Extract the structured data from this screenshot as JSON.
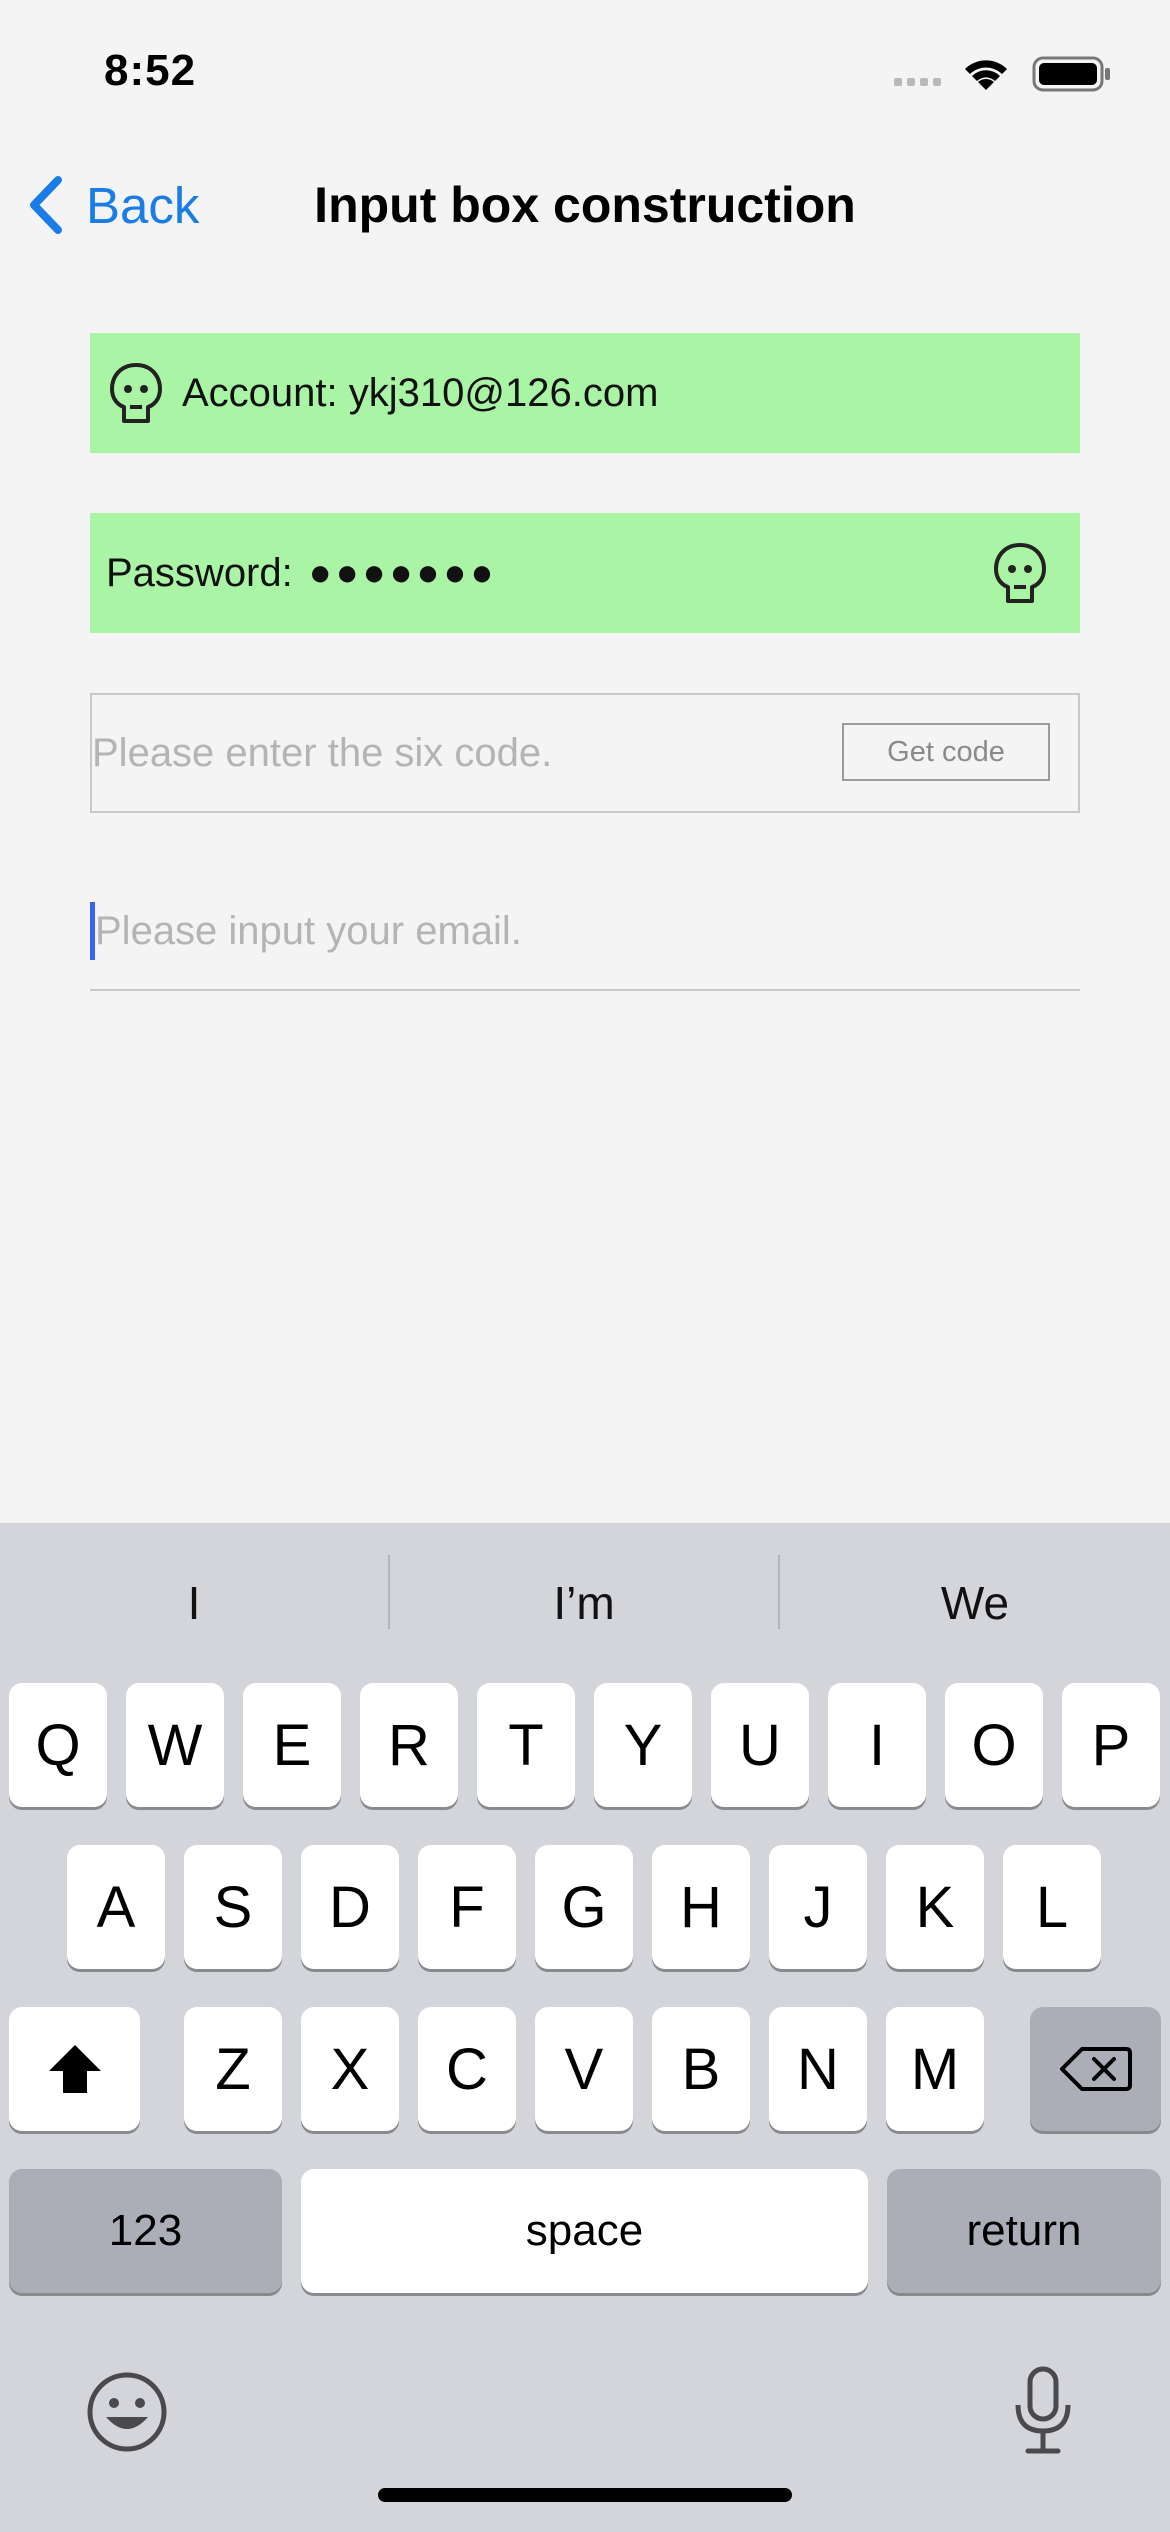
{
  "status_bar": {
    "time": "8:52"
  },
  "nav": {
    "back_label": "Back",
    "title": "Input box construction"
  },
  "form": {
    "account_text": "Account: ykj310@126.com",
    "password_label": "Password: ",
    "password_mask": "●●●●●●●",
    "code_placeholder": "Please enter the six code.",
    "get_code_label": "Get code",
    "email_placeholder": "Please input your email."
  },
  "colors": {
    "field_green": "#aaf5a5",
    "accent_blue": "#1a7ce6",
    "caret": "#3a63f0"
  },
  "keyboard": {
    "suggestions": [
      "I",
      "I’m",
      "We"
    ],
    "row1": [
      "Q",
      "W",
      "E",
      "R",
      "T",
      "Y",
      "U",
      "I",
      "O",
      "P"
    ],
    "row2": [
      "A",
      "S",
      "D",
      "F",
      "G",
      "H",
      "J",
      "K",
      "L"
    ],
    "row3": [
      "Z",
      "X",
      "C",
      "V",
      "B",
      "N",
      "M"
    ],
    "numbers_label": "123",
    "space_label": "space",
    "return_label": "return"
  }
}
